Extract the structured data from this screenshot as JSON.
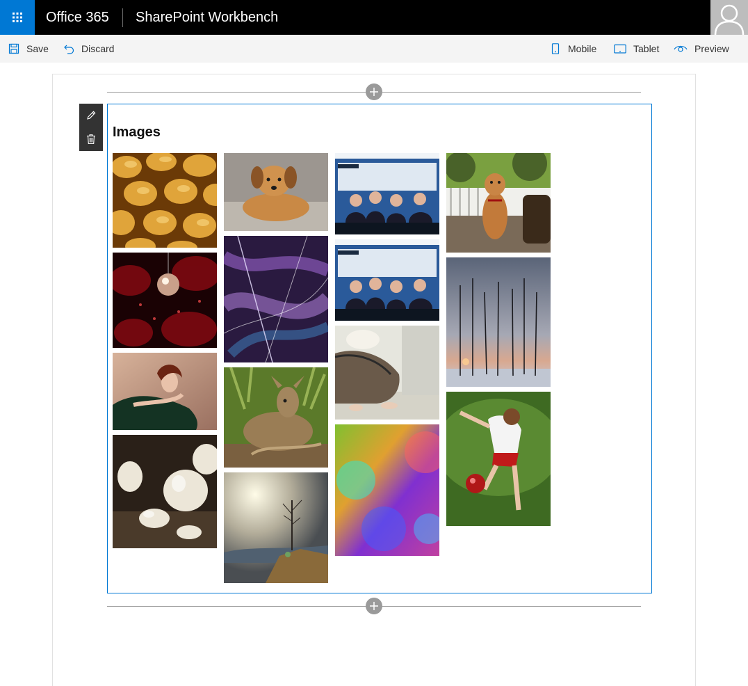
{
  "suitebar": {
    "brand": "Office 365",
    "app_title": "SharePoint Workbench",
    "waffle_icon": "app-launcher-icon",
    "accent": "#0078d4"
  },
  "commands": {
    "save": "Save",
    "discard": "Discard",
    "mobile": "Mobile",
    "tablet": "Tablet",
    "preview": "Preview"
  },
  "webpart": {
    "title": "Images",
    "toolbar": [
      "edit-icon",
      "delete-icon"
    ],
    "images": [
      "bread-rolls",
      "puppy",
      "people-on-bus",
      "dog-on-porch",
      "disco-ball",
      "abstract-swirl",
      "people-on-bus-2",
      "winter-trees",
      "woman-in-dress",
      "fawn",
      "woman-sitting",
      "girl-kicking-ball",
      "garlic",
      "lone-tree-landscape",
      "colorful-bokeh"
    ]
  }
}
